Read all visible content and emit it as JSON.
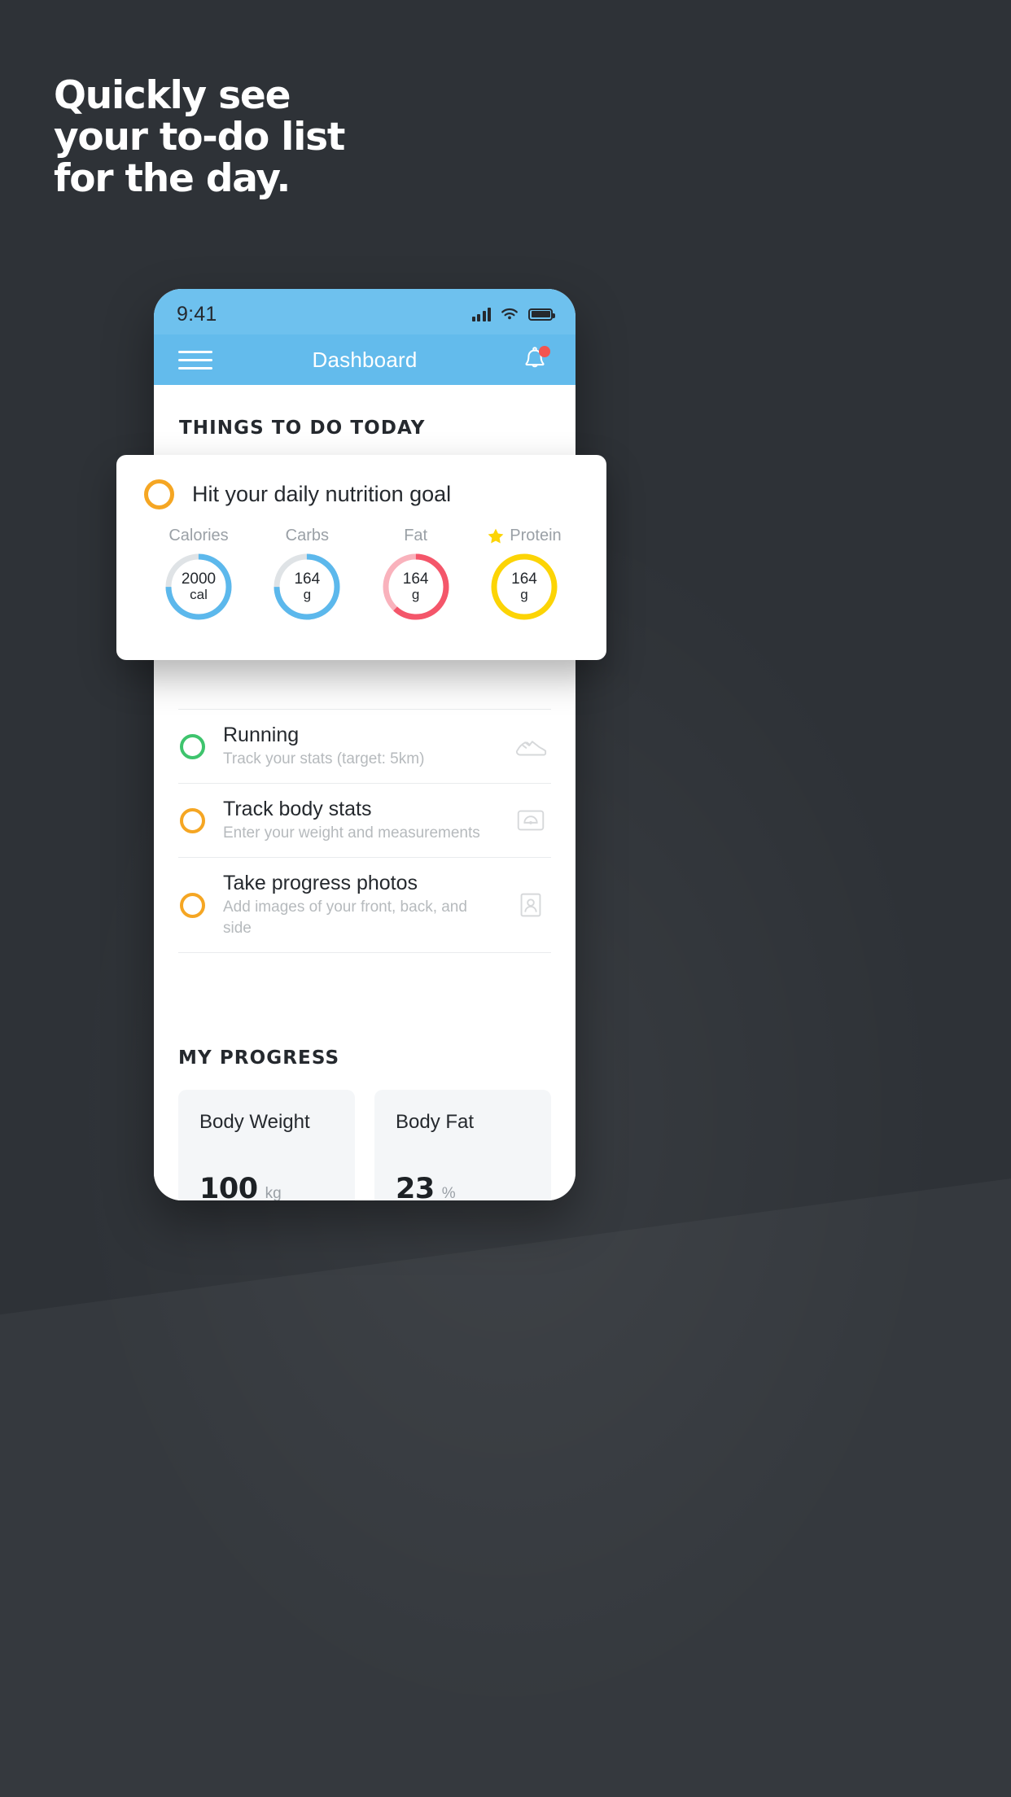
{
  "promo": {
    "headline": "Quickly see\nyour to-do list\nfor the day."
  },
  "phone": {
    "status_bar": {
      "time": "9:41",
      "signal_icon": "cellular-signal-icon",
      "wifi_icon": "wifi-icon",
      "battery_icon": "battery-icon"
    },
    "nav": {
      "menu_icon": "hamburger-menu-icon",
      "title": "Dashboard",
      "bell_icon": "notification-bell-icon",
      "has_badge": true
    },
    "sections": {
      "todo_title": "THINGS TO DO TODAY",
      "progress_title": "MY PROGRESS"
    },
    "tasks": [
      {
        "title": "Running",
        "subtitle": "Track your stats (target: 5km)",
        "ring_color": "#3ec46d",
        "icon": "running-shoe-icon"
      },
      {
        "title": "Track body stats",
        "subtitle": "Enter your weight and measurements",
        "ring_color": "#f5a623",
        "icon": "weight-scale-icon"
      },
      {
        "title": "Take progress photos",
        "subtitle": "Add images of your front, back, and side",
        "ring_color": "#f5a623",
        "icon": "portrait-photo-icon"
      }
    ],
    "progress_cards": [
      {
        "label": "Body Weight",
        "value": "100",
        "unit": "kg"
      },
      {
        "label": "Body Fat",
        "value": "23",
        "unit": "%"
      }
    ]
  },
  "nutrition_card": {
    "ring_color": "#f5a623",
    "title": "Hit your daily nutrition goal",
    "star_icon": "star-icon",
    "macros": [
      {
        "label": "Calories",
        "value": "2000",
        "unit": "cal",
        "color": "#5cb8ec",
        "track": "#dfe3e6",
        "percent": 75,
        "starred": false
      },
      {
        "label": "Carbs",
        "value": "164",
        "unit": "g",
        "color": "#5cb8ec",
        "track": "#dfe3e6",
        "percent": 75,
        "starred": false
      },
      {
        "label": "Fat",
        "value": "164",
        "unit": "g",
        "color": "#f4566a",
        "track": "#f9b2bc",
        "percent": 62,
        "starred": false
      },
      {
        "label": "Protein",
        "value": "164",
        "unit": "g",
        "color": "#fcd405",
        "track": "#fcd405",
        "percent": 100,
        "starred": true
      }
    ]
  },
  "colors": {
    "background": "#2e3237",
    "nav_blue": "#63bbec",
    "status_blue": "#6ec1ee",
    "amber": "#f5a623",
    "green": "#3ec46d",
    "red": "#f4566a",
    "yellow": "#fcd405",
    "spark_blue": "#4fb3e8"
  }
}
